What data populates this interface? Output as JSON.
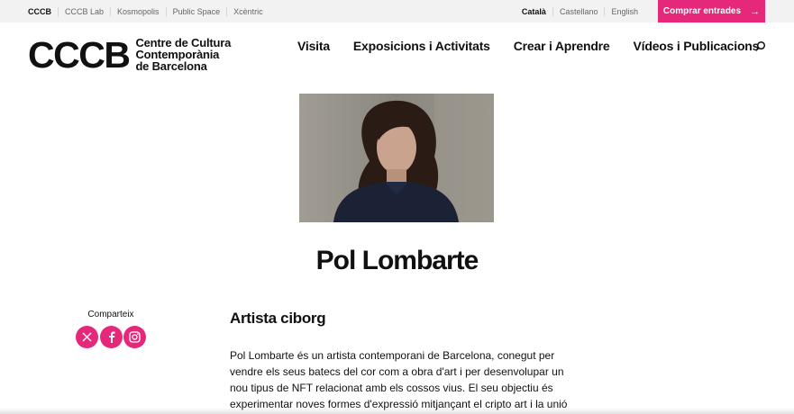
{
  "topbar": {
    "sites": [
      "CCCB",
      "CCCB Lab",
      "Kosmopolis",
      "Public Space",
      "Xcèntric"
    ],
    "languages": [
      "Català",
      "Castellano",
      "English"
    ],
    "buy_label": "Comprar entrades",
    "buy_icon": "arrow-right-icon",
    "accent": "#e5287a"
  },
  "logo": {
    "mark": "CCCB",
    "line1": "Centre de Cultura",
    "line2": "Contemporània",
    "line3": "de Barcelona"
  },
  "nav": {
    "items": [
      "Visita",
      "Exposicions i Activitats",
      "Crear i Aprendre",
      "Vídeos i Publicacions"
    ],
    "search_icon": "search-icon"
  },
  "profile": {
    "name": "Pol Lombarte",
    "subtitle": "Artista ciborg",
    "bio": "Pol Lombarte és un artista contemporani de Barcelona, conegut per vendre els seus batecs del cor com a obra d'art i per desenvolupar un nou tipus de NFT relacionat amb els cossos vius. El seu objectiu és experimentar noves formes d'expressió mitjançant el cripto art i la unió entre el seu cos i la"
  },
  "share": {
    "label": "Comparteix",
    "icons": [
      "x-icon",
      "facebook-icon",
      "instagram-icon"
    ]
  }
}
